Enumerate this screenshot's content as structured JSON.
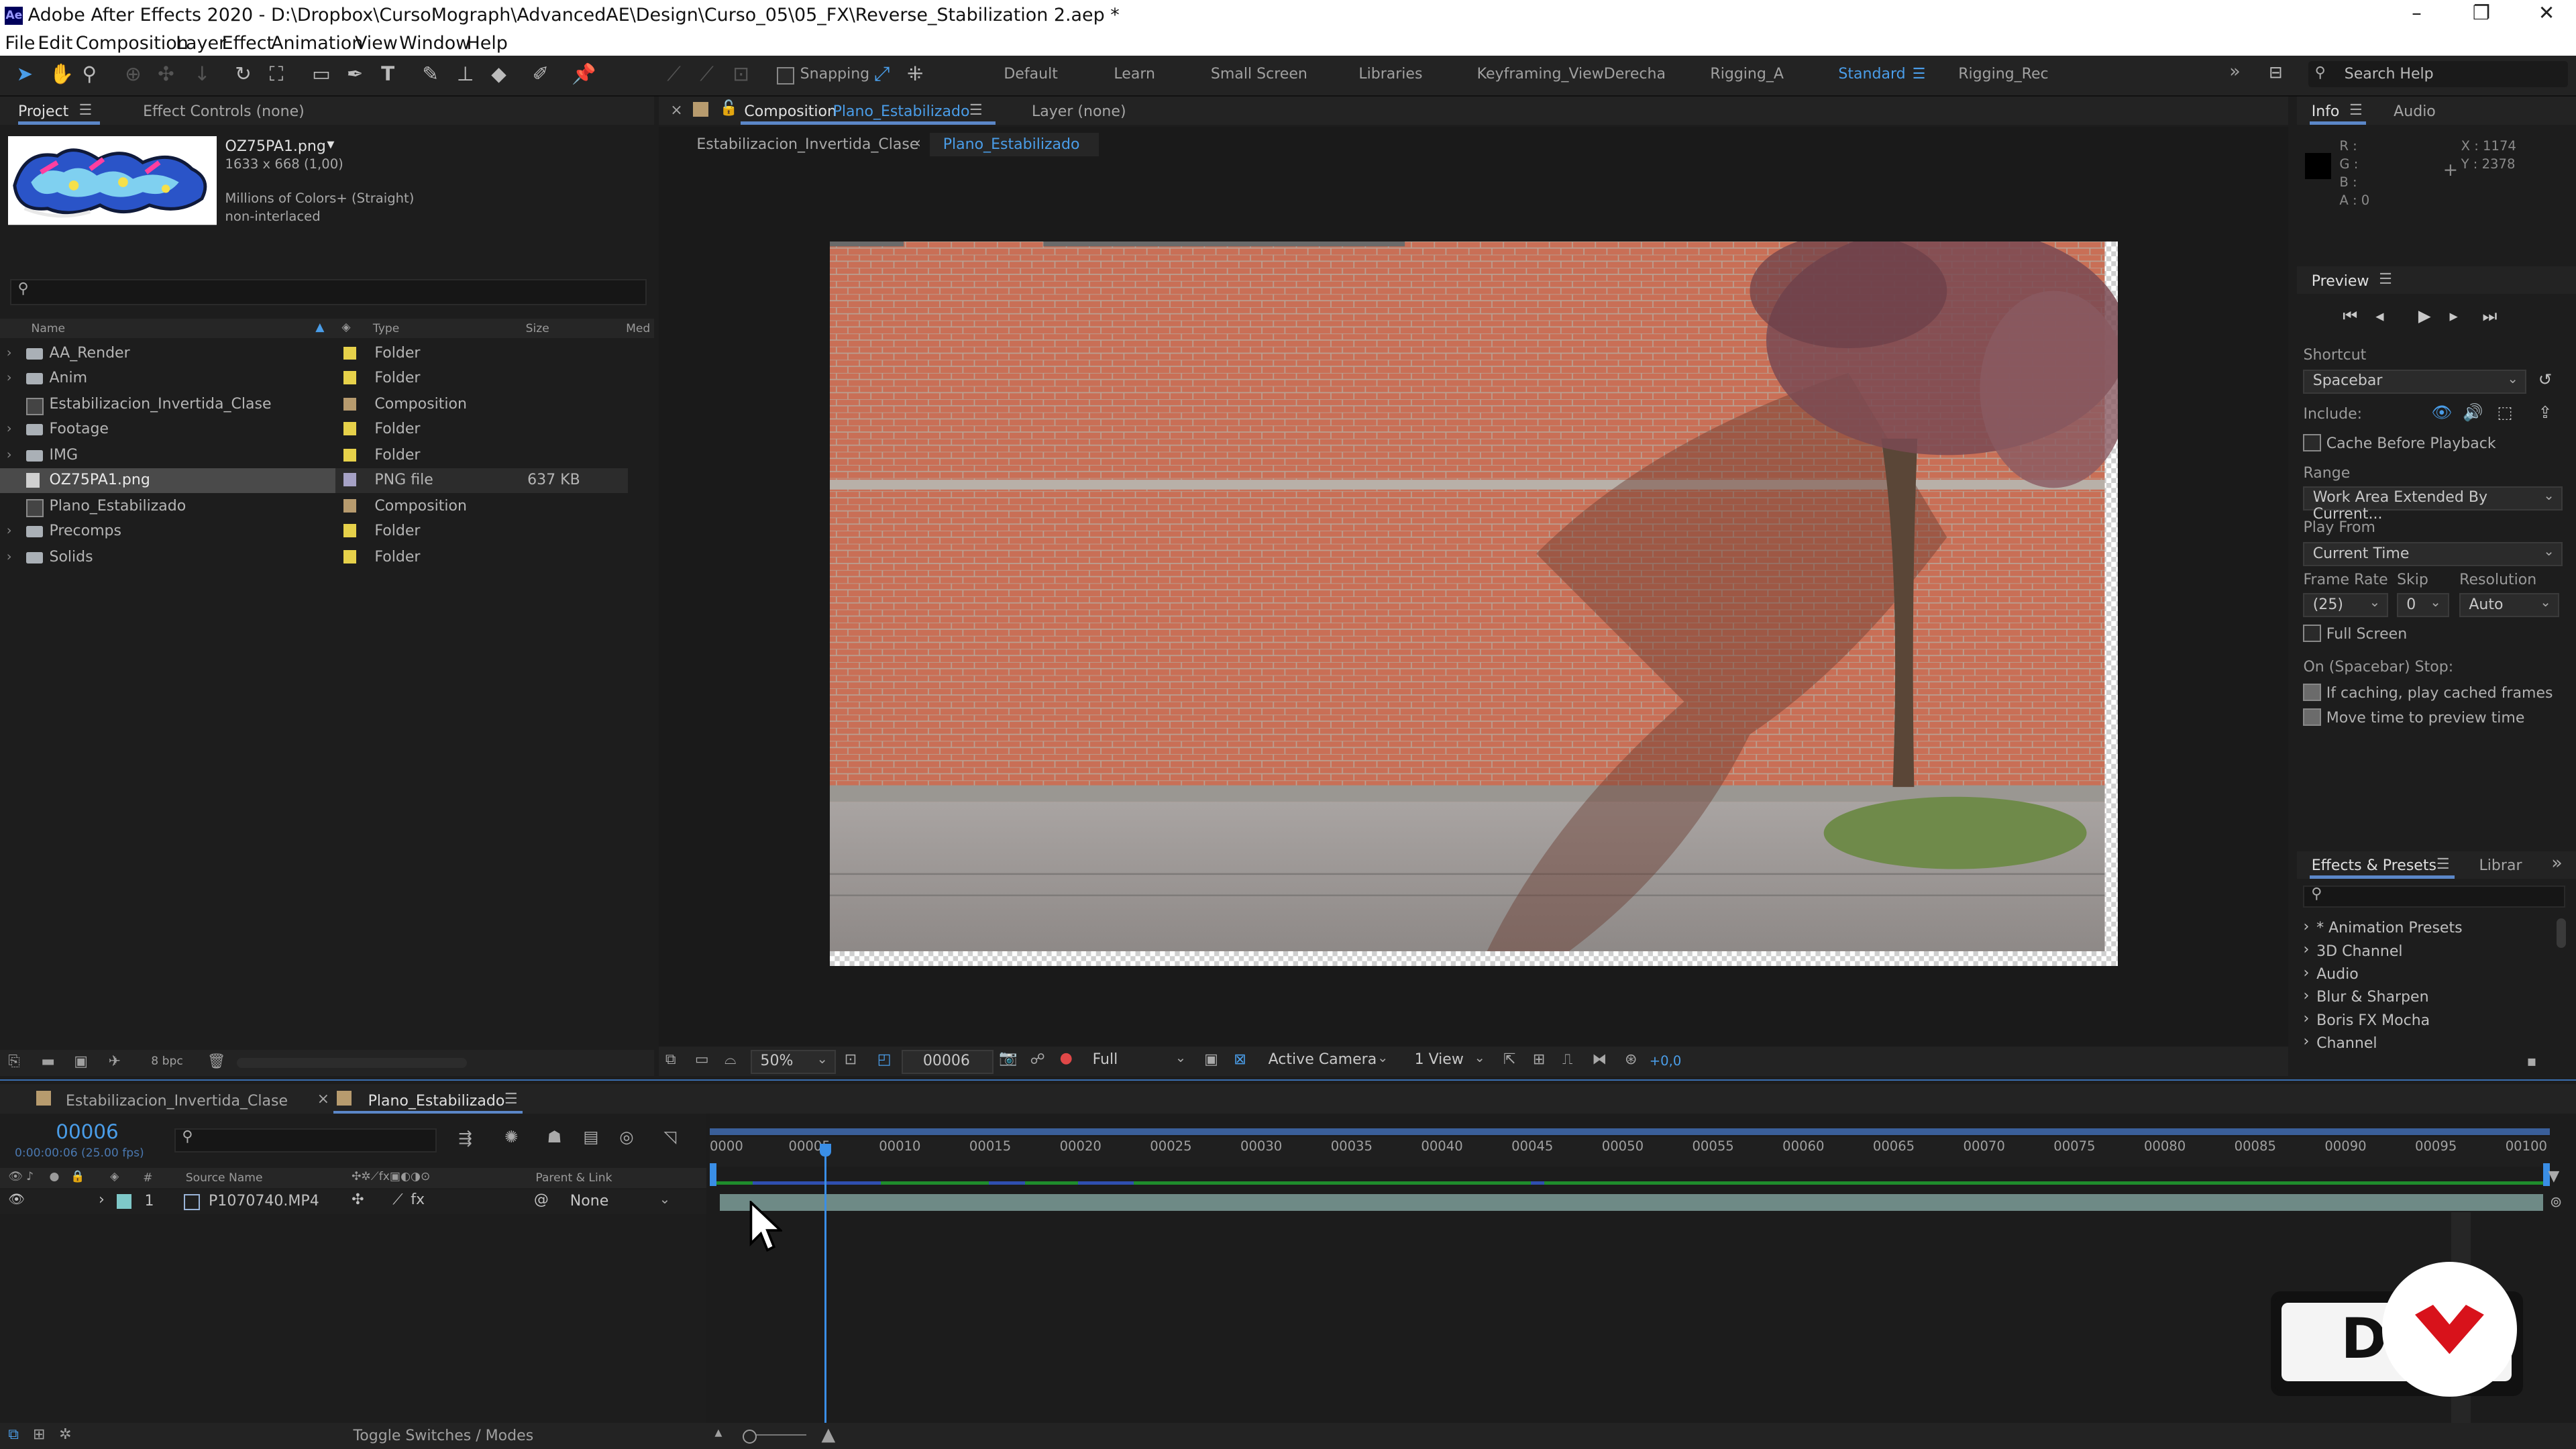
{
  "window": {
    "title": "Adobe After Effects 2020 - D:\\Dropbox\\CursoMograph\\AdvancedAE\\Design\\Curso_05\\05_FX\\Reverse_Stabilization 2.aep *",
    "app_icon": "Ae",
    "controls": {
      "minimize": "–",
      "restore": "❐",
      "close": "✕"
    }
  },
  "menu": [
    "File",
    "Edit",
    "Composition",
    "Layer",
    "Effect",
    "Animation",
    "View",
    "Window",
    "Help"
  ],
  "toolbar": {
    "snapping_label": "Snapping",
    "workspaces": [
      "Default",
      "Learn",
      "Small Screen",
      "Libraries",
      "Keyframing_ViewDerecha",
      "Rigging_A",
      "Standard",
      "Rigging_Rec"
    ],
    "active_workspace": "Standard",
    "more": "»",
    "search_placeholder": "Search Help"
  },
  "project_panel": {
    "tab_project": "Project",
    "tab_effect_controls": "Effect Controls (none)",
    "preview": {
      "filename": "OZ75PA1.png",
      "dims": "1633 x 668 (1,00)",
      "colors": "Millions of Colors+ (Straight)",
      "interlace": "non-interlaced"
    },
    "columns": {
      "name": "Name",
      "type": "Type",
      "size": "Size",
      "media": "Med"
    },
    "items": [
      {
        "name": "AA_Render",
        "type": "Folder",
        "size": "",
        "kind": "folder",
        "color": "#e6d14a"
      },
      {
        "name": "Anim",
        "type": "Folder",
        "size": "",
        "kind": "folder",
        "color": "#e6d14a"
      },
      {
        "name": "Estabilizacion_Invertida_Clase",
        "type": "Composition",
        "size": "",
        "kind": "comp",
        "color": "#b79b6e"
      },
      {
        "name": "Footage",
        "type": "Folder",
        "size": "",
        "kind": "folder",
        "color": "#e6d14a"
      },
      {
        "name": "IMG",
        "type": "Folder",
        "size": "",
        "kind": "folder",
        "color": "#e6d14a"
      },
      {
        "name": "OZ75PA1.png",
        "type": "PNG file",
        "size": "637 KB",
        "kind": "png",
        "color": "#a6a2c6"
      },
      {
        "name": "Plano_Estabilizado",
        "type": "Composition",
        "size": "",
        "kind": "comp",
        "color": "#b79b6e"
      },
      {
        "name": "Precomps",
        "type": "Folder",
        "size": "",
        "kind": "folder",
        "color": "#e6d14a"
      },
      {
        "name": "Solids",
        "type": "Folder",
        "size": "",
        "kind": "folder",
        "color": "#e6d14a"
      }
    ],
    "bpc": "8 bpc"
  },
  "composition_panel": {
    "tab_label": "Composition",
    "tab_comp": "Plano_Estabilizado",
    "tab_layer": "Layer (none)",
    "breadcrumb": [
      "Estabilizacion_Invertida_Clase",
      "Plano_Estabilizado"
    ],
    "footer": {
      "zoom": "50%",
      "timecode": "00006",
      "resolution": "Full",
      "camera": "Active Camera",
      "view": "1 View",
      "exposure": "+0,0"
    }
  },
  "info_panel": {
    "tab_info": "Info",
    "tab_audio": "Audio",
    "r": "R :",
    "g": "G :",
    "b": "B :",
    "a": "A : 0",
    "x": "X : 1174",
    "y": "Y : 2378"
  },
  "preview_panel": {
    "title": "Preview",
    "shortcut_label": "Shortcut",
    "shortcut": "Spacebar",
    "include_label": "Include:",
    "cache_before": "Cache Before Playback",
    "range_label": "Range",
    "range": "Work Area Extended By Current...",
    "play_from_label": "Play From",
    "play_from": "Current Time",
    "frame_rate_label": "Frame Rate",
    "skip_label": "Skip",
    "resolution_label": "Resolution",
    "frame_rate": "(25)",
    "skip": "0",
    "resolution": "Auto",
    "full_screen": "Full Screen",
    "stop_label": "On (Spacebar) Stop:",
    "if_caching": "If caching, play cached frames",
    "move_time": "Move time to preview time"
  },
  "effects_panel": {
    "tab_effects": "Effects & Presets",
    "tab_libraries": "Librar",
    "items": [
      "* Animation Presets",
      "3D Channel",
      "Audio",
      "Blur & Sharpen",
      "Boris FX Mocha",
      "Channel"
    ]
  },
  "timeline": {
    "tab1": "Estabilizacion_Invertida_Clase",
    "tab2": "Plano_Estabilizado",
    "timecode": "00006",
    "timecode_sub": "0:00:00:06 (25.00 fps)",
    "col_hash": "#",
    "col_source": "Source Name",
    "col_parent": "Parent & Link",
    "layer": {
      "num": "1",
      "name": "P1070740.MP4",
      "parent": "None"
    },
    "ticks": [
      "0000",
      "00005",
      "00010",
      "00015",
      "00020",
      "00025",
      "00030",
      "00035",
      "00040",
      "00045",
      "00050",
      "00055",
      "00060",
      "00065",
      "00070",
      "00075",
      "00080",
      "00085",
      "00090",
      "00095",
      "00100"
    ],
    "toggle_label": "Toggle Switches / Modes"
  },
  "overlay_logo_text": "D"
}
